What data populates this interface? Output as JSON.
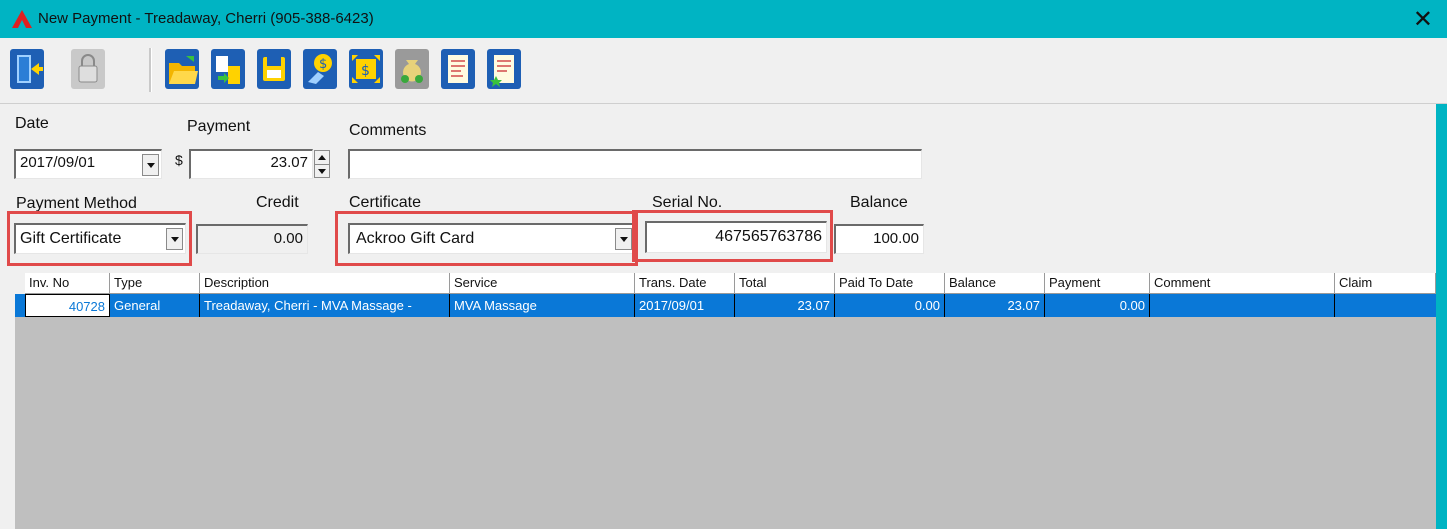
{
  "window": {
    "title": "New Payment - Treadaway, Cherri (905-388-6423)",
    "close": "✕"
  },
  "toolbar": {
    "buttons": [
      {
        "icon": "exit-door-icon"
      },
      {
        "icon": "lock-icon"
      },
      {
        "icon": "open-folder-icon"
      },
      {
        "icon": "transfer-icon"
      },
      {
        "icon": "save-icon"
      },
      {
        "icon": "payment-hand-icon"
      },
      {
        "icon": "dollar-exchange-icon"
      },
      {
        "icon": "money-bag-icon"
      },
      {
        "icon": "report-icon"
      },
      {
        "icon": "report-star-icon"
      }
    ]
  },
  "form": {
    "date_label": "Date",
    "date_value": "2017/09/01",
    "payment_label": "Payment",
    "currency_symbol": "$",
    "payment_value": "23.07",
    "comments_label": "Comments",
    "comments_value": "",
    "method_label": "Payment Method",
    "method_value": "Gift Certificate",
    "credit_label": "Credit",
    "credit_value": "0.00",
    "certificate_label": "Certificate",
    "certificate_value": "Ackroo Gift Card",
    "serial_label": "Serial No.",
    "serial_value": "467565763786",
    "balance_label": "Balance",
    "balance_value": "100.00"
  },
  "grid": {
    "columns": [
      "Inv. No",
      "Type",
      "Description",
      "Service",
      "Trans. Date",
      "Total",
      "Paid To Date",
      "Balance",
      "Payment",
      "Comment",
      "Claim"
    ],
    "rows": [
      {
        "inv_no": "40728",
        "type": "General",
        "description": "Treadaway, Cherri - MVA Massage - ",
        "service": "MVA Massage",
        "trans_date": "2017/09/01",
        "total": "23.07",
        "paid_to_date": "0.00",
        "balance": "23.07",
        "payment": "0.00",
        "comment": "",
        "claim": ""
      }
    ]
  },
  "colors": {
    "title_bar": "#00b4c3",
    "selection": "#0a78d7",
    "highlight": "#e04a4a"
  }
}
